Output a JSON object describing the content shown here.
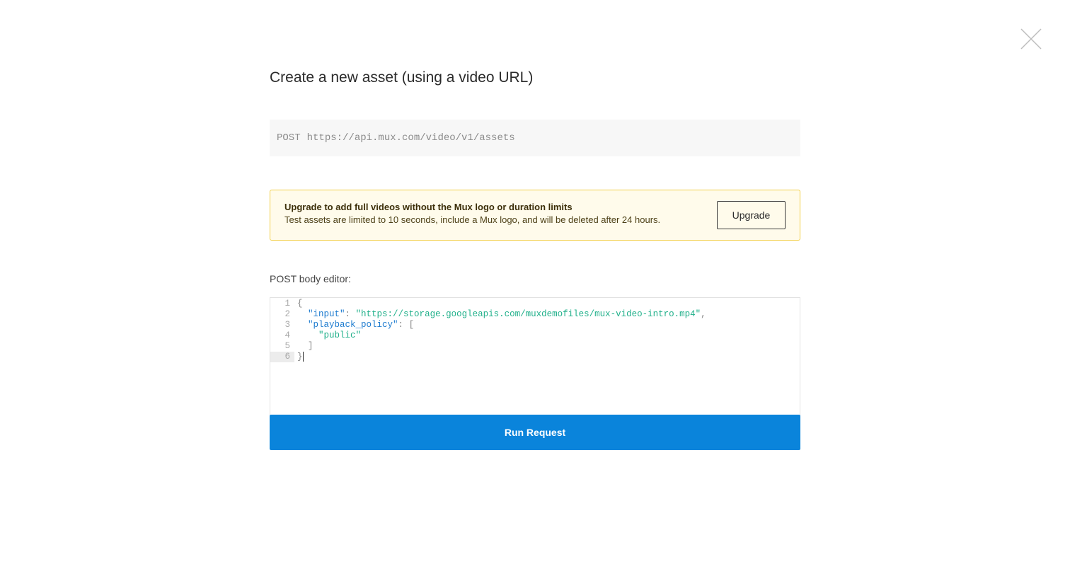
{
  "modal": {
    "close_icon": "close-icon",
    "title": "Create a new asset (using a video URL)"
  },
  "endpoint": {
    "method": "POST",
    "url": "https://api.mux.com/video/v1/assets"
  },
  "notice": {
    "title": "Upgrade to add full videos without the Mux logo or duration limits",
    "text": "Test assets are limited to 10 seconds, include a Mux logo, and will be deleted after 24 hours.",
    "button_label": "Upgrade",
    "border_color": "#f2cf48",
    "background_color": "#fffbeb"
  },
  "editor": {
    "label": "POST body editor:",
    "lines": [
      {
        "number": "1",
        "open_brace": "{"
      },
      {
        "number": "2",
        "key": "\"input\"",
        "colon": ": ",
        "value": "\"https://storage.googleapis.com/muxdemofiles/mux-video-intro.mp4\"",
        "comma": ","
      },
      {
        "number": "3",
        "key": "\"playback_policy\"",
        "colon": ": ",
        "bracket": "["
      },
      {
        "number": "4",
        "value": "\"public\""
      },
      {
        "number": "5",
        "bracket": "]"
      },
      {
        "number": "6",
        "close_brace": "}"
      }
    ],
    "key_color": "#1d7bcf",
    "string_color": "#20b08a"
  },
  "run_button": {
    "label": "Run Request",
    "color": "#0a84db"
  }
}
